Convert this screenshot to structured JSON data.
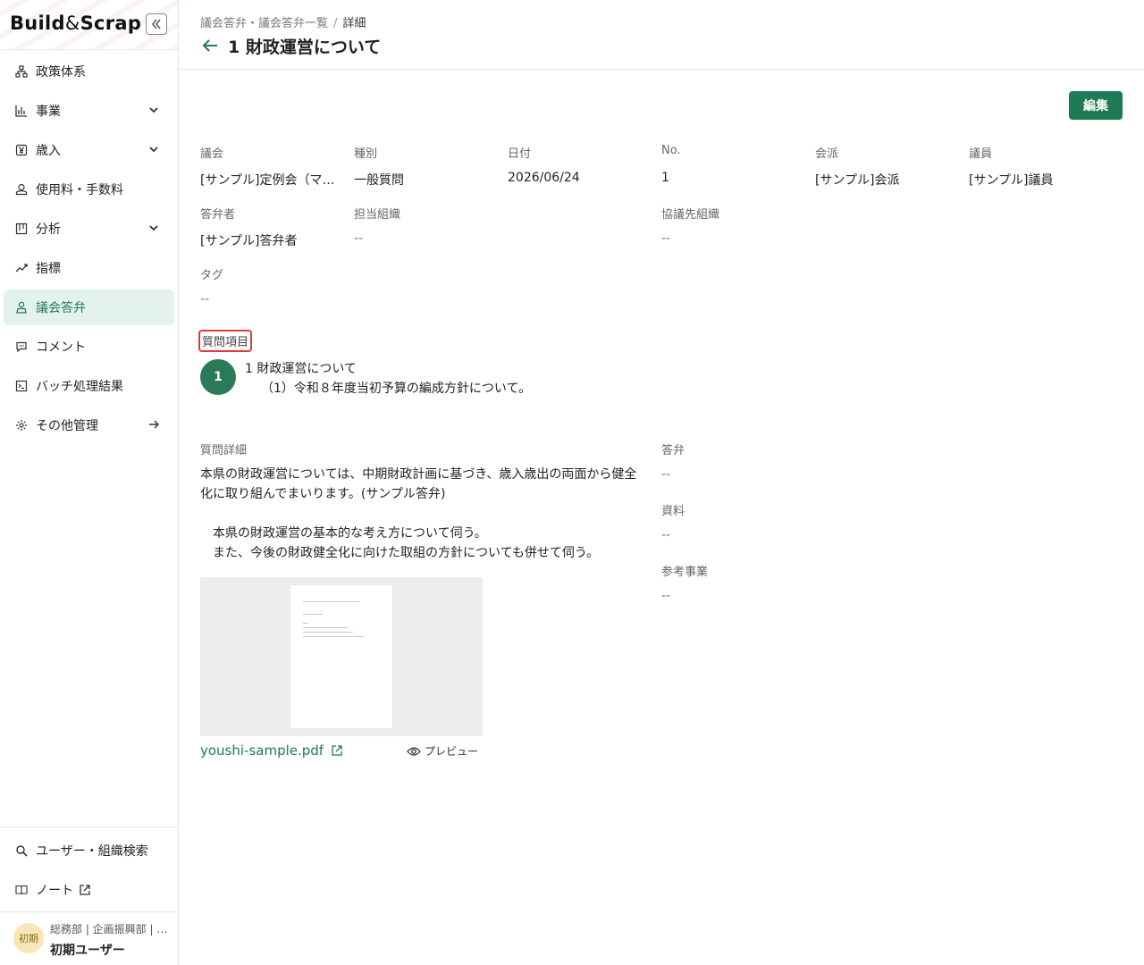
{
  "app": {
    "logo_part1": "Build",
    "logo_amp": "&",
    "logo_part2": "Scrap",
    "collapse_icon": "double-chevron-left-icon"
  },
  "sidebar": {
    "items": [
      {
        "label": "政策体系",
        "icon": "hierarchy-icon",
        "expandable": false,
        "active": false
      },
      {
        "label": "事業",
        "icon": "bar-chart-icon",
        "expandable": true,
        "active": false
      },
      {
        "label": "歳入",
        "icon": "yen-icon",
        "expandable": true,
        "active": false
      },
      {
        "label": "使用料・手数料",
        "icon": "coins-icon",
        "expandable": false,
        "active": false
      },
      {
        "label": "分析",
        "icon": "board-icon",
        "expandable": true,
        "active": false
      },
      {
        "label": "指標",
        "icon": "trend-icon",
        "expandable": false,
        "active": false
      },
      {
        "label": "議会答弁",
        "icon": "podium-icon",
        "expandable": false,
        "active": true
      },
      {
        "label": "コメント",
        "icon": "comment-icon",
        "expandable": false,
        "active": false
      },
      {
        "label": "バッチ処理結果",
        "icon": "terminal-icon",
        "expandable": false,
        "active": false
      },
      {
        "label": "その他管理",
        "icon": "settings-icon",
        "expandable": false,
        "active": false,
        "arrow": true
      }
    ],
    "bottom_items": [
      {
        "label": "ユーザー・組織検索",
        "icon": "search-icon"
      },
      {
        "label": "ノート",
        "icon": "book-icon",
        "external": true
      }
    ],
    "user": {
      "avatar": "初期",
      "org": "総務部 | 企画振興部 | …",
      "name": "初期ユーザー"
    }
  },
  "header": {
    "breadcrumb": [
      "議会答弁・議会答弁一覧",
      "詳細"
    ],
    "separator": "/",
    "title": "1 財政運営について"
  },
  "actions": {
    "edit_label": "編集"
  },
  "fields": {
    "row1": [
      {
        "label": "議会",
        "value": "[サンプル]定例会（マ…"
      },
      {
        "label": "種別",
        "value": "一般質問"
      },
      {
        "label": "日付",
        "value": "2026/06/24"
      },
      {
        "label": "No.",
        "value": "1"
      },
      {
        "label": "会派",
        "value": "[サンプル]会派"
      },
      {
        "label": "議員",
        "value": "[サンプル]議員"
      }
    ],
    "row2": [
      {
        "label": "答弁者",
        "value": "[サンプル]答弁者"
      },
      {
        "label": "担当組織",
        "value": "--"
      },
      {
        "label": "協議先組織",
        "value": "--"
      }
    ],
    "tag": {
      "label": "タグ",
      "value": "--"
    }
  },
  "question_items": {
    "label": "質問項目",
    "number": "1",
    "title": "1 財政運営について",
    "sub": "（1）令和８年度当初予算の編成方針について。"
  },
  "detail": {
    "label": "質問詳細",
    "text1_line1": "本県の財政運営については、中期財政計画に基づき、歳入歳出の両面から健全",
    "text1_line2": "化に取り組んでまいります。(サンプル答弁)",
    "text2_line1": "　本県の財政運営の基本的な考え方について伺う。",
    "text2_line2": "　また、今後の財政健全化に向けた取組の方針についても併せて伺う。"
  },
  "attachment": {
    "filename": "youshi-sample.pdf",
    "preview_label": "プレビュー"
  },
  "right_fields": [
    {
      "label": "答弁",
      "value": "--"
    },
    {
      "label": "資料",
      "value": "--"
    },
    {
      "label": "参考事業",
      "value": "--"
    }
  ],
  "colors": {
    "accent": "#1f7a55",
    "active_bg": "#e3f2ec",
    "highlight_border": "#e03a3a"
  }
}
